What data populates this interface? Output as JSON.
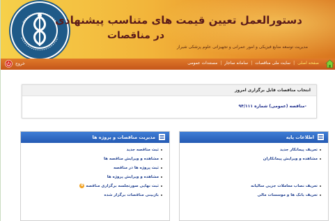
{
  "header": {
    "title_line1": "دستورالعمل تعیین قیمت های متناسب پیشنهادی",
    "title_line2": "در مناقصات",
    "subtitle": "مدیریت توسعه منابع فیزیکی و امور عمرانی و تجهیزاتی علوم پزشکی شیراز"
  },
  "nav": {
    "items": [
      {
        "label": "صفحه اصلی",
        "active": true
      },
      {
        "label": "سایت ملی مناقصات"
      },
      {
        "label": "سامانه ساجار"
      },
      {
        "label": "مستندات عمومی"
      }
    ],
    "exit_label": "خروج"
  },
  "announce": {
    "title": "انتخاب مناقصات قابل برگزاری امروز",
    "link": "-مناقصه (عمومی) شماره ۹۴/۱۱۱"
  },
  "panels": {
    "right": {
      "title": "اطلاعات پایه",
      "items": [
        "تعریف پیمانکار جدید",
        "مشاهده و ویرایش پیمانکاران",
        "",
        "تعریف نصاب معاملات جزیی سالیانه",
        "تعریف بانک ها و موسسات مالی"
      ]
    },
    "left": {
      "title": "مدیریت مناقصات و پروژه ها",
      "items": [
        "ثبت مناقصه جدید",
        "مشاهده و ویرایش مناقصه ها",
        "ثبت پروژه ها در مناقصه",
        "مشاهده و ویرایش پروژه ها",
        "ثبت نهایی صورتجلسه برگزاری مناقصه",
        "بازبینی مناقصات برگزار شده"
      ],
      "badge_value": "0"
    }
  },
  "colors": {
    "header_gradient_start": "#f6d04a",
    "header_gradient_end": "#d9761f",
    "nav_bar": "#c5561a",
    "panel_head": "#2f6cc4",
    "link_text": "#1f3f8f",
    "background": "#d8ecd0"
  },
  "icons": {
    "logo": "university-seal-logo",
    "home": "home-icon",
    "exit": "power-icon",
    "panel": "list-window-icon"
  }
}
